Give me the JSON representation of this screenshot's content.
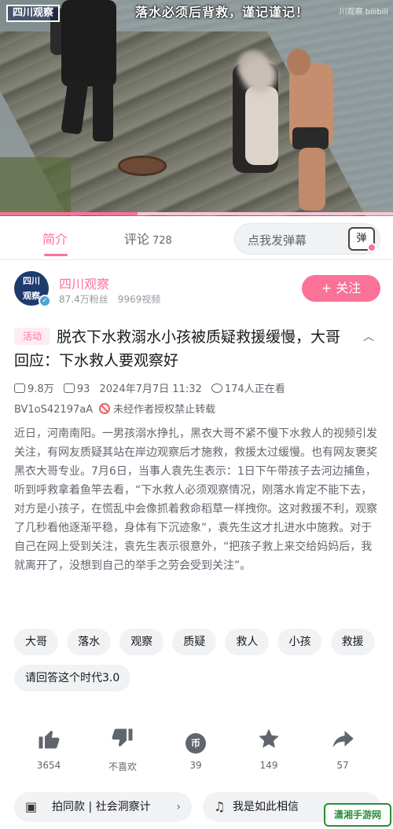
{
  "video": {
    "logo": "四川观察",
    "caption": "落水必须后背救，谨记谨记！",
    "watermark": "川观察 bilibili",
    "progress": 0.35
  },
  "tabs": {
    "intro": "简介",
    "comment": "评论",
    "comment_count": "728",
    "danmaku_placeholder": "点我发弹幕",
    "danmaku_button": "弹"
  },
  "author": {
    "avatar_text_1": "四川",
    "avatar_text_2": "观察",
    "name": "四川观察",
    "fans": "87.4万粉丝",
    "videos": "9969视频",
    "follow_label": "+ 关注"
  },
  "video_info": {
    "badge": "活动",
    "title": "脱衣下水救溺水小孩被质疑救援缓慢，大哥回应：下水救人要观察好",
    "views": "9.8万",
    "danmaku_count": "93",
    "date": "2024年7月7日 11:32",
    "watching": "174人正在看",
    "bvid": "BV1oS42197aA",
    "no_repost": "未经作者授权禁止转载",
    "description": "近日，河南南阳。一男孩溺水挣扎，黑衣大哥不紧不慢下水救人的视频引发关注，有网友质疑其站在岸边观察后才施救，救援太过缓慢。也有网友褒奖黑衣大哥专业。7月6日，当事人袁先生表示：1日下午带孩子去河边捕鱼，听到呼救拿着鱼竿去看，“下水救人必须观察情况，刚落水肯定不能下去，对方是小孩子，在慌乱中会像抓着救命稻草一样拽你。这对救援不利，观察了几秒看他逐渐平稳，身体有下沉迹象”，袁先生这才扎进水中施救。对于自己在网上受到关注，袁先生表示很意外，“把孩子救上来交给妈妈后，我就离开了，没想到自己的举手之劳会受到关注”。"
  },
  "tags": [
    "大哥",
    "落水",
    "观察",
    "质疑",
    "救人",
    "小孩",
    "救援",
    "请回答这个时代3.0"
  ],
  "actions": {
    "like": "3654",
    "dislike": "不喜欢",
    "coin": "39",
    "coin_icon_text": "币",
    "favorite": "149",
    "share": "57"
  },
  "bottom": {
    "pill_a": "拍同款 | 社会洞察计",
    "pill_b": "我是如此相信",
    "site_logo": "潇湘手游网"
  },
  "icons": [
    "thumb-up-icon",
    "thumb-down-icon",
    "coin-icon",
    "star-icon",
    "share-icon",
    "play-count-icon",
    "danmaku-icon",
    "watching-icon",
    "ban-icon",
    "chevron-up-icon",
    "chevron-right-icon",
    "music-icon",
    "video-template-icon"
  ],
  "colors": {
    "accent": "#fb7299",
    "text": "#18191c",
    "muted": "#61666d",
    "tag_bg": "#f1f2f3"
  }
}
